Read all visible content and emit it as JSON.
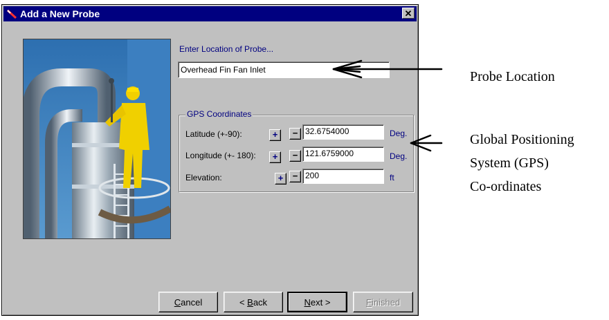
{
  "window": {
    "title": "Add a New Probe",
    "close_glyph": "✕"
  },
  "location": {
    "label": "Enter Location of Probe...",
    "value": "Overhead Fin Fan Inlet"
  },
  "gps": {
    "legend": "GPS Coordinates",
    "rows": [
      {
        "label": "Latitude (+-90):",
        "value": "32.6754000",
        "unit": "Deg."
      },
      {
        "label": "Longitude (+- 180):",
        "value": "121.6759000",
        "unit": "Deg."
      },
      {
        "label": "Elevation:",
        "value": "200",
        "unit": "ft"
      }
    ],
    "plus": "+",
    "minus": "−"
  },
  "buttons": {
    "cancel": {
      "pre": "",
      "u": "C",
      "post": "ancel"
    },
    "back": {
      "pre": "< ",
      "u": "B",
      "post": "ack"
    },
    "next": {
      "pre": "",
      "u": "N",
      "post": "ext >"
    },
    "finished": {
      "pre": "",
      "u": "F",
      "post": "inished"
    }
  },
  "annotations": {
    "probe_location": "Probe Location",
    "gps_line1": "Global Positioning",
    "gps_line2": "System (GPS)",
    "gps_line3": "Co-ordinates"
  },
  "colors": {
    "titlebar": "#000080",
    "dialog": "#c0c0c0",
    "label_blue": "#000080"
  }
}
